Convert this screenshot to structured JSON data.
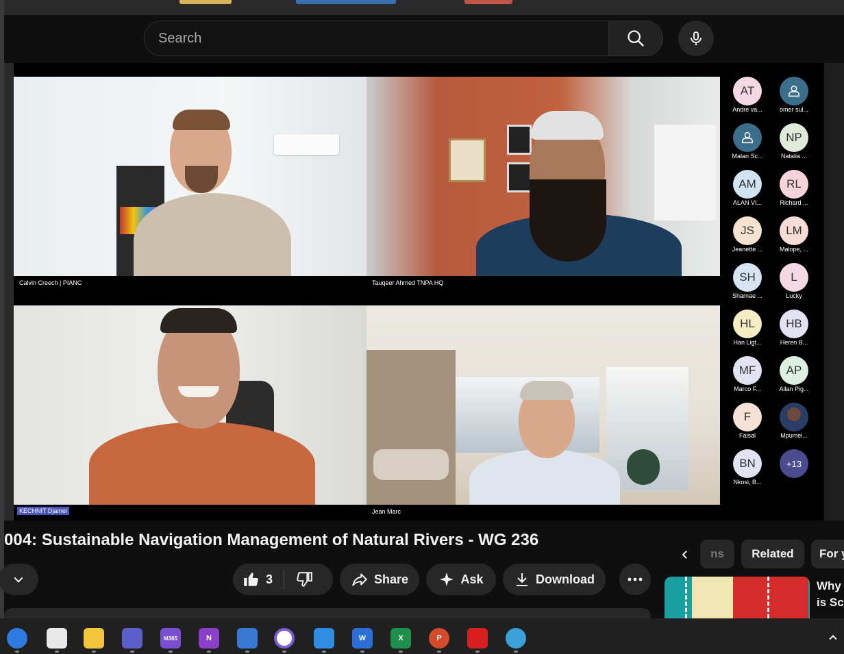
{
  "search": {
    "placeholder": "Search"
  },
  "video": {
    "title": "004: Sustainable Navigation Management of Natural Rivers - WG 236",
    "tiles": [
      {
        "name": "Calvin Creech | PIANC"
      },
      {
        "name": "Tauqeer Ahmed  TNPA HQ"
      },
      {
        "name": "KECHNIT Djamel"
      },
      {
        "name": "Jean Marc"
      }
    ],
    "attendees": [
      {
        "initials": "AT",
        "name": "Andre va...",
        "color": "#f4d9e4"
      },
      {
        "initials": "",
        "name": "omer sul...",
        "color": "#3b6e8a",
        "icon": "person-icon"
      },
      {
        "initials": "",
        "name": "Malan Sc...",
        "color": "#3b6e8a",
        "icon": "person-icon"
      },
      {
        "initials": "NP",
        "name": "Natalia ...",
        "color": "#e0ead8"
      },
      {
        "initials": "AM",
        "name": "ALAN VI...",
        "color": "#cfe3f3"
      },
      {
        "initials": "RL",
        "name": "Richard ...",
        "color": "#f7d4dc"
      },
      {
        "initials": "JS",
        "name": "Jeanette ...",
        "color": "#f7e2cf"
      },
      {
        "initials": "LM",
        "name": "Malope, ...",
        "color": "#f7dcd6"
      },
      {
        "initials": "SH",
        "name": "Sharnae ...",
        "color": "#d6e4f3"
      },
      {
        "initials": "L",
        "name": "Lucky",
        "color": "#f4d9e4"
      },
      {
        "initials": "HL",
        "name": "Han Ligt...",
        "color": "#f7edc4"
      },
      {
        "initials": "HB",
        "name": "Heren B...",
        "color": "#e2e2f3"
      },
      {
        "initials": "MF",
        "name": "Marco F...",
        "color": "#e2e2f3"
      },
      {
        "initials": "AP",
        "name": "Allan Pig...",
        "color": "#dcefe1"
      },
      {
        "initials": "F",
        "name": "Faisal",
        "color": "#f7e2d6"
      },
      {
        "initials": "",
        "name": "Mpumel...",
        "color": "#7a8aa8",
        "icon": "photo-avatar"
      },
      {
        "initials": "BN",
        "name": "Nkosi, B...",
        "color": "#e2e2f3"
      },
      {
        "initials": "+13",
        "name": "",
        "color": "#4b4c8f"
      }
    ]
  },
  "actions": {
    "like_count": "3",
    "share": "Share",
    "ask": "Ask",
    "download": "Download"
  },
  "chips": {
    "partial": "ns",
    "related": "Related",
    "for_you": "For y"
  },
  "related_video": {
    "title_line1": "Why",
    "title_line2": "is Sc"
  },
  "taskbar": {
    "apps": [
      {
        "icon": "edge-icon",
        "label": ""
      },
      {
        "icon": "notepad-icon",
        "label": ""
      },
      {
        "icon": "file-explorer-icon",
        "label": ""
      },
      {
        "icon": "teams-icon",
        "label": ""
      },
      {
        "icon": "m365-icon",
        "label": "M365"
      },
      {
        "icon": "onenote-icon",
        "label": "N"
      },
      {
        "icon": "sticky-icon",
        "label": ""
      },
      {
        "icon": "media-player-icon",
        "label": ""
      },
      {
        "icon": "photos-icon",
        "label": ""
      },
      {
        "icon": "word-icon",
        "label": "W"
      },
      {
        "icon": "excel-icon",
        "label": "X"
      },
      {
        "icon": "powerpoint-icon",
        "label": "P"
      },
      {
        "icon": "acrobat-icon",
        "label": ""
      },
      {
        "icon": "paint-icon",
        "label": ""
      }
    ]
  }
}
